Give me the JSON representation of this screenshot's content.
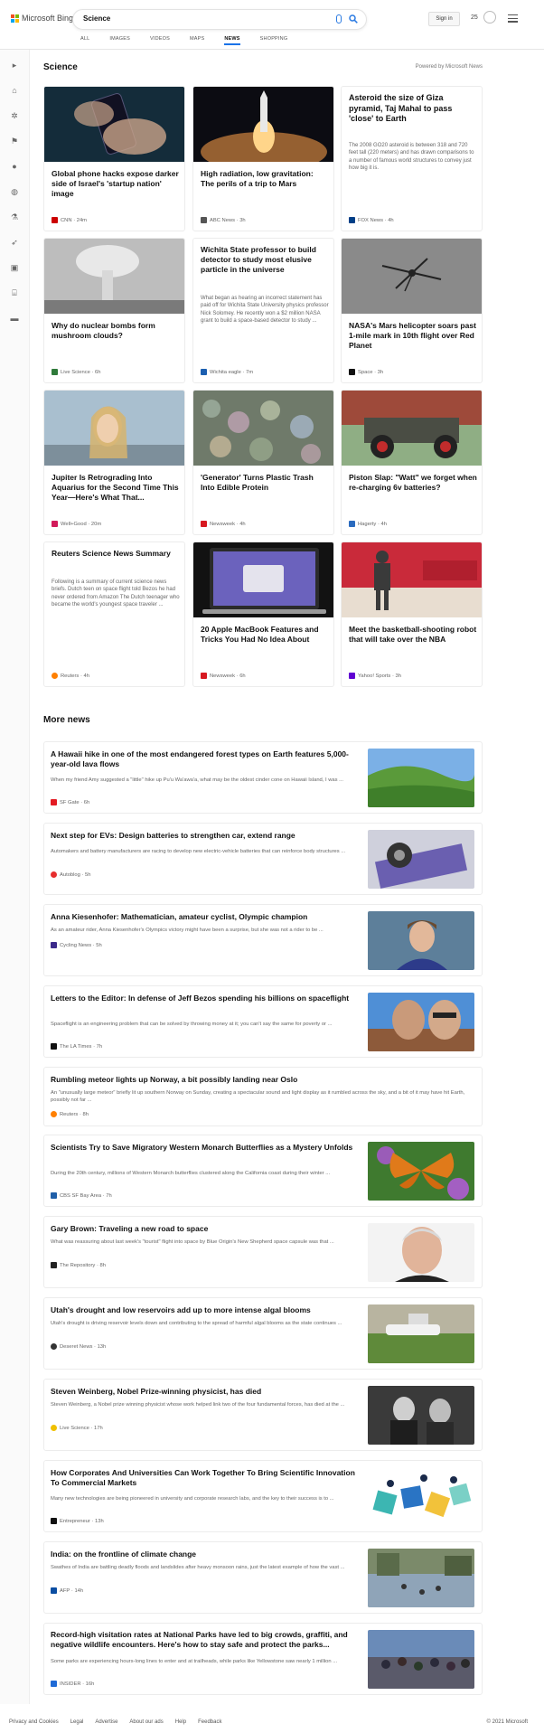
{
  "header": {
    "logo_text": "Microsoft Bing",
    "query": "Science",
    "signin": "Sign in",
    "rewards_count": "25",
    "tabs": [
      "ALL",
      "IMAGES",
      "VIDEOS",
      "MAPS",
      "NEWS",
      "SHOPPING"
    ]
  },
  "section": {
    "title": "Science",
    "powered": "Powered by Microsoft News"
  },
  "cards": [
    {
      "title": "Global phone hacks expose darker side of Israel's 'startup nation' image",
      "source": "CNN",
      "time": "· 24m",
      "desc": ""
    },
    {
      "title": "High radiation, low gravitation: The perils of a trip to Mars",
      "source": "ABC News",
      "time": "· 3h",
      "desc": ""
    },
    {
      "title": "Asteroid the size of Giza pyramid, Taj Mahal to pass 'close' to Earth",
      "source": "FOX News",
      "time": "· 4h",
      "desc": "The 2008 GO20 asteroid is between 318 and 720 feet tall (220 meters) and has drawn comparisons to a number of famous world structures to convey just how big it is."
    },
    {
      "title": "Why do nuclear bombs form mushroom clouds?",
      "source": "Live Science",
      "time": "· 6h",
      "desc": ""
    },
    {
      "title": "Wichita State professor to build detector to study most elusive particle in the universe",
      "source": "Wichita eagle",
      "time": "· 7m",
      "desc": "What began as hearing an incorrect statement has paid off for Wichita State University physics professor Nick Solomey. He recently won a $2 million NASA grant to build a space-based detector to study ..."
    },
    {
      "title": "NASA's Mars helicopter soars past 1-mile mark in 10th flight over Red Planet",
      "source": "Space",
      "time": "· 3h",
      "desc": ""
    },
    {
      "title": "Jupiter Is Retrograding Into Aquarius for the Second Time This Year—Here's What That...",
      "source": "Well+Good",
      "time": "· 20m",
      "desc": ""
    },
    {
      "title": "'Generator' Turns Plastic Trash Into Edible Protein",
      "source": "Newsweek",
      "time": "· 4h",
      "desc": ""
    },
    {
      "title": "Piston Slap: \"Watt\" we forget when re-charging 6v batteries?",
      "source": "Hagerty",
      "time": "· 4h",
      "desc": ""
    },
    {
      "title": "Reuters Science News Summary",
      "source": "Reuters",
      "time": "· 4h",
      "desc": "Following is a summary of current science news briefs. Dutch teen on space flight told Bezos he had never ordered from Amazon The Dutch teenager who became the world's youngest space traveler ..."
    },
    {
      "title": "20 Apple MacBook Features and Tricks You Had No Idea About",
      "source": "Newsweek",
      "time": "· 6h",
      "desc": ""
    },
    {
      "title": "Meet the basketball-shooting robot that will take over the NBA",
      "source": "Yahoo! Sports",
      "time": "· 3h",
      "desc": ""
    }
  ],
  "more_title": "More news",
  "more": [
    {
      "title": "A Hawaii hike in one of the most endangered forest types on Earth features 5,000-year-old lava flows",
      "desc": "When my friend Amy suggested a \"little\" hike up Pu'u Wa'awa'a, what may be the oldest cinder cone on Hawaii Island, I was ...",
      "source": "SF Gate",
      "time": "· 6h"
    },
    {
      "title": "Next step for EVs: Design batteries to strengthen car, extend range",
      "desc": "Automakers and battery manufacturers are racing to develop new electric-vehicle batteries that can reinforce body structures ...",
      "source": "Autoblog",
      "time": "· 5h"
    },
    {
      "title": "Anna Kiesenhofer: Mathematician, amateur cyclist, Olympic champion",
      "desc": "As an amateur rider, Anna Kiesenhofer's Olympics victory might have been a surprise, but she was not a rider to be ...",
      "source": "Cycling News",
      "time": "· 5h"
    },
    {
      "title": "Letters to the Editor: In defense of Jeff Bezos spending his billions on spaceflight",
      "desc": "Spaceflight is an engineering problem that can be solved by throwing money at it; you can't say the same for poverty or ...",
      "source": "The LA Times",
      "time": "· 7h"
    },
    {
      "title": "Rumbling meteor lights up Norway, a bit possibly landing near Oslo",
      "desc": "An \"unusually large meteor\" briefly lit up southern Norway on Sunday, creating a spectacular sound and light display as it rumbled across the sky, and a bit of it may have hit Earth, possibly not far ...",
      "source": "Reuters",
      "time": "· 8h"
    },
    {
      "title": "Scientists Try to Save Migratory Western Monarch Butterflies as a Mystery Unfolds",
      "desc": "During the 20th century, millions of Western Monarch butterflies clustered along the California coast during their winter ...",
      "source": "CBS SF Bay Area",
      "time": "· 7h"
    },
    {
      "title": "Gary Brown: Traveling a new road to space",
      "desc": "What was reassuring about last week's \"tourist\" flight into space by Blue Origin's New Shepherd space capsule was that ...",
      "source": "The Repository",
      "time": "· 8h"
    },
    {
      "title": "Utah's drought and low reservoirs add up to more intense algal blooms",
      "desc": "Utah's drought is driving reservoir levels down and contributing to the spread of harmful algal blooms as the state continues ...",
      "source": "Deseret News",
      "time": "· 13h"
    },
    {
      "title": "Steven Weinberg, Nobel Prize-winning physicist, has died",
      "desc": "Steven Weinberg, a Nobel prize winning physicist whose work helped link two of the four fundamental forces, has died at the ...",
      "source": "Live Science",
      "time": "· 17h"
    },
    {
      "title": "How Corporates And Universities Can Work Together To Bring Scientific Innovation To Commercial Markets",
      "desc": "Many new technologies are being pioneered in university and corporate research labs, and the key to their success is to ...",
      "source": "Entrepreneur",
      "time": "· 13h"
    },
    {
      "title": "India: on the frontline of climate change",
      "desc": "Swathes of India are battling deadly floods and landslides after heavy monsoon rains, just the latest example of how the vast ...",
      "source": "AFP",
      "time": "· 14h"
    },
    {
      "title": "Record-high visitation rates at National Parks have led to big crowds, graffiti, and negative wildlife encounters. Here's how to stay safe and protect the parks...",
      "desc": "Some parks are experiencing hours-long lines to enter and at trailheads, while parks like Yellowstone saw nearly 1 million ...",
      "source": "INSIDER",
      "time": "· 16h"
    }
  ],
  "footer": {
    "links": [
      "Privacy and Cookies",
      "Legal",
      "Advertise",
      "About our ads",
      "Help",
      "Feedback"
    ],
    "copyright": "© 2021 Microsoft"
  }
}
